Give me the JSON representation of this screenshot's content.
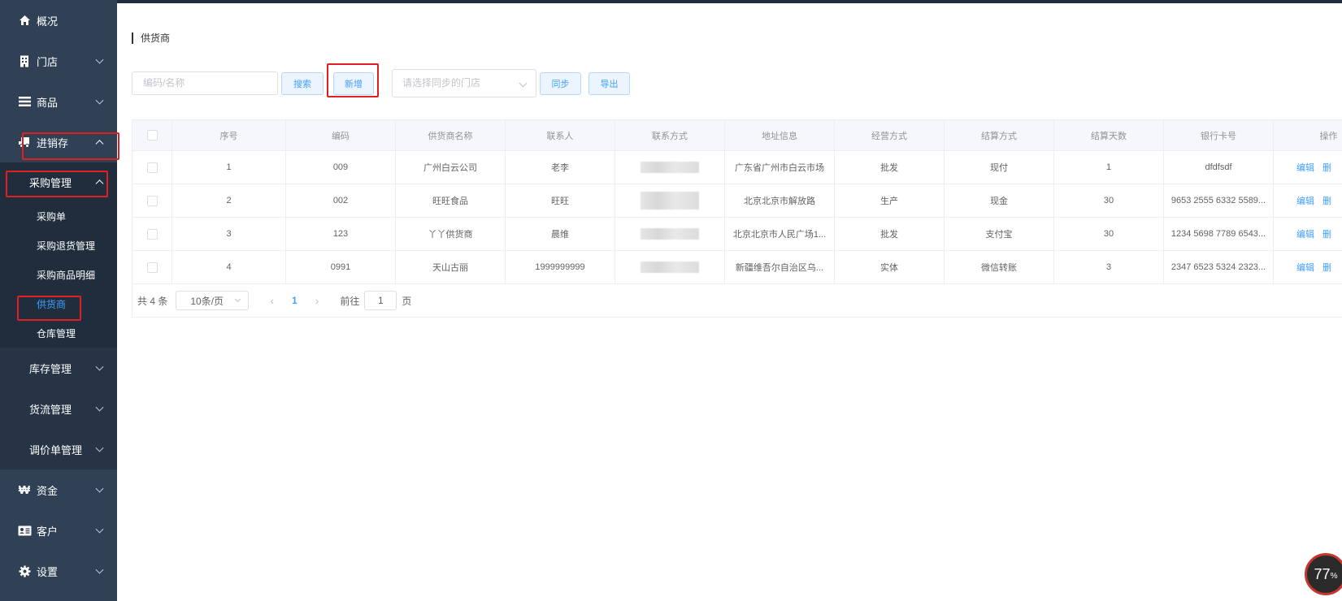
{
  "sidebar": {
    "top_items": [
      {
        "label": "概况",
        "icon": "home-icon"
      },
      {
        "label": "门店",
        "icon": "building-icon"
      },
      {
        "label": "商品",
        "icon": "menu-icon"
      }
    ],
    "active_group": {
      "label": "进销存",
      "icon": "truck-icon"
    },
    "submenu_title": "采购管理",
    "submenu_leaves": [
      "采购单",
      "采购退货管理",
      "采购商品明细",
      "供货商",
      "仓库管理"
    ],
    "active_leaf": "供货商",
    "sub_groups": [
      "库存管理",
      "货流管理",
      "调价单管理"
    ],
    "bottom_items": [
      {
        "label": "资金",
        "icon": "won-icon"
      },
      {
        "label": "客户",
        "icon": "id-card-icon"
      },
      {
        "label": "设置",
        "icon": "gear-icon"
      }
    ]
  },
  "page": {
    "title": "供货商"
  },
  "toolbar": {
    "search_placeholder": "编码/名称",
    "search_label": "搜索",
    "add_label": "新增",
    "store_select_placeholder": "请选择同步的门店",
    "sync_label": "同步",
    "export_label": "导出"
  },
  "table": {
    "columns": [
      "序号",
      "编码",
      "供货商名称",
      "联系人",
      "联系方式",
      "地址信息",
      "经营方式",
      "结算方式",
      "结算天数",
      "银行卡号",
      "操作"
    ],
    "rows": [
      {
        "index": "1",
        "code": "009",
        "name": "广州白云公司",
        "contact": "老李",
        "address": "广东省广州市白云市场",
        "mode": "批发",
        "settle": "现付",
        "days": "1",
        "bank": "dfdfsdf"
      },
      {
        "index": "2",
        "code": "002",
        "name": "旺旺食品",
        "contact": "旺旺",
        "address": "北京北京市解放路",
        "mode": "生产",
        "settle": "现金",
        "days": "30",
        "bank": "9653 2555 6332 5589..."
      },
      {
        "index": "3",
        "code": "123",
        "name": "丫丫供货商",
        "contact": "晨维",
        "address": "北京北京市人民广场1...",
        "mode": "批发",
        "settle": "支付宝",
        "days": "30",
        "bank": "1234 5698 7789 6543..."
      },
      {
        "index": "4",
        "code": "0991",
        "name": "天山古丽",
        "contact": "1999999999",
        "address": "新疆维吾尔自治区乌...",
        "mode": "实体",
        "settle": "微信转账",
        "days": "3",
        "bank": "2347 6523 5324 2323..."
      }
    ],
    "edit_label": "编辑",
    "delete_label": "删"
  },
  "pagination": {
    "total": "共 4 条",
    "page_size": "10条/页",
    "current_page": "1",
    "goto_prefix": "前往",
    "goto_value": "1",
    "goto_suffix": "页"
  },
  "progress_badge": {
    "value": "77",
    "unit": "%"
  },
  "colors": {
    "sidebar": "#304156",
    "submenu": "#1f2d3d",
    "accent": "#409eff",
    "highlight": "#e02020"
  }
}
